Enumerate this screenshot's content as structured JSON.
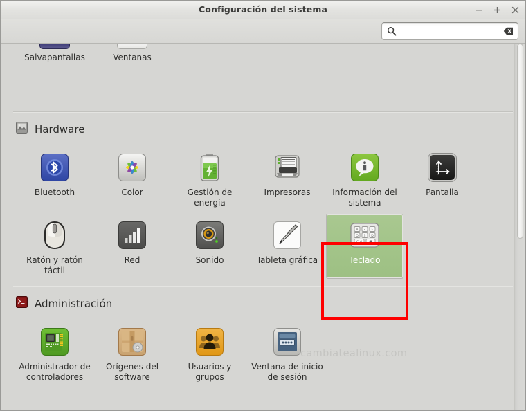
{
  "window": {
    "title": "Configuración del sistema",
    "buttons": {
      "minimize": "minimize-icon",
      "maximize": "maximize-icon",
      "close": "close-icon"
    }
  },
  "search": {
    "icon": "search-icon",
    "clear_icon": "clear-icon",
    "value": "",
    "placeholder": ""
  },
  "watermark": "cambiatealinux.com",
  "partial_row": {
    "items": [
      {
        "label": "Salvapantallas",
        "icon": "screensaver-icon"
      },
      {
        "label": "Ventanas",
        "icon": "windows-icon"
      }
    ]
  },
  "sections": [
    {
      "id": "hardware",
      "title": "Hardware",
      "icon": "hardware-icon",
      "items": [
        {
          "label": "Bluetooth",
          "icon": "bluetooth-icon",
          "selected": false
        },
        {
          "label": "Color",
          "icon": "color-icon",
          "selected": false
        },
        {
          "label": "Gestión de energía",
          "icon": "power-icon",
          "selected": false
        },
        {
          "label": "Impresoras",
          "icon": "printer-icon",
          "selected": false
        },
        {
          "label": "Información del sistema",
          "icon": "system-info-icon",
          "selected": false
        },
        {
          "label": "Pantalla",
          "icon": "display-icon",
          "selected": false
        },
        {
          "label": "Ratón y ratón táctil",
          "icon": "mouse-icon",
          "selected": false
        },
        {
          "label": "Red",
          "icon": "network-icon",
          "selected": false
        },
        {
          "label": "Sonido",
          "icon": "sound-icon",
          "selected": false
        },
        {
          "label": "Tableta gráfica",
          "icon": "tablet-icon",
          "selected": false
        },
        {
          "label": "Teclado",
          "icon": "keyboard-icon",
          "selected": true
        }
      ]
    },
    {
      "id": "administracion",
      "title": "Administración",
      "icon": "administration-icon",
      "items": [
        {
          "label": "Administrador de controladores",
          "icon": "driver-manager-icon",
          "selected": false
        },
        {
          "label": "Orígenes del software",
          "icon": "software-sources-icon",
          "selected": false
        },
        {
          "label": "Usuarios y grupos",
          "icon": "users-groups-icon",
          "selected": false
        },
        {
          "label": "Ventana de inicio de sesión",
          "icon": "login-window-icon",
          "selected": false
        }
      ]
    }
  ],
  "colors": {
    "selection_green": "#9fc184",
    "annotation_red": "#fe0000",
    "window_bg": "#d6d6d3",
    "title_text": "#3b3b39"
  }
}
